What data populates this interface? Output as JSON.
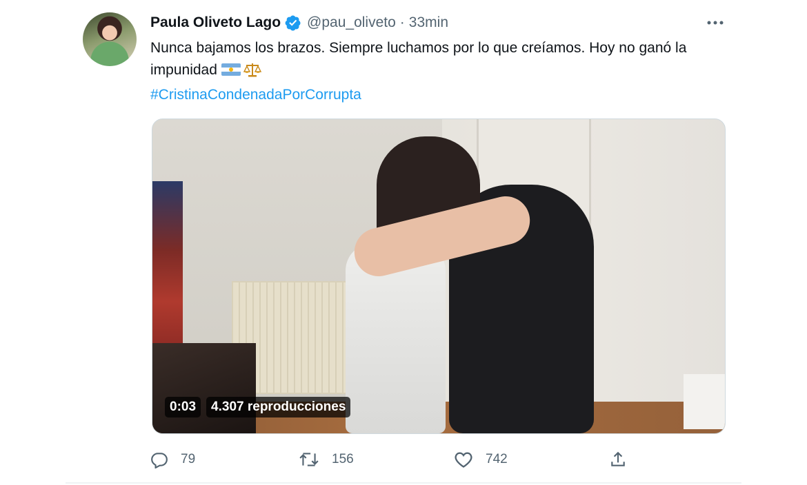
{
  "author": {
    "name": "Paula Oliveto Lago",
    "handle": "@pau_oliveto",
    "separator": "·",
    "time": "33min"
  },
  "tweet": {
    "text": "Nunca bajamos los brazos. Siempre luchamos por lo que creíamos. Hoy no ganó la impunidad",
    "emoji": [
      "argentina-flag",
      "balance-scale"
    ],
    "hashtag": "#CristinaCondenadaPorCorrupta"
  },
  "video": {
    "duration": "0:03",
    "views": "4.307 reproducciones"
  },
  "actions": {
    "replies": "79",
    "retweets": "156",
    "likes": "742"
  },
  "colors": {
    "link": "#1d9bf0",
    "verified": "#1d9bf0",
    "muted": "#536471",
    "text": "#0f1419"
  }
}
